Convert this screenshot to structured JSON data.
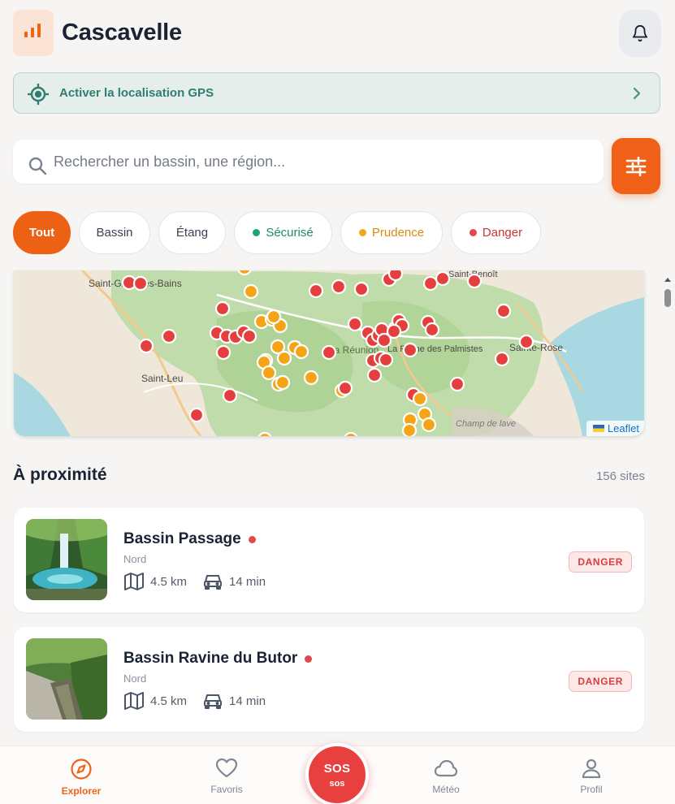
{
  "app": {
    "title": "Cascavelle"
  },
  "gps": {
    "label": "Activer la localisation GPS"
  },
  "search": {
    "placeholder": "Rechercher un bassin, une région..."
  },
  "filters": [
    {
      "label": "Tout",
      "active": true
    },
    {
      "label": "Bassin"
    },
    {
      "label": "Étang"
    },
    {
      "label": "Sécurisé",
      "dot_color": "#1aa37e",
      "text_color": "#1a8d6e"
    },
    {
      "label": "Prudence",
      "dot_color": "#f4a51b",
      "text_color": "#d98a10"
    },
    {
      "label": "Danger",
      "dot_color": "#e54848",
      "text_color": "#c93434"
    }
  ],
  "map": {
    "place_labels": [
      "Saint-Gilles-les-Bains",
      "Saint-Leu",
      "La Réunion",
      "La Plaine des Palmistes",
      "Saint-Benoît",
      "Sainte-Rose",
      "Champ de lave"
    ],
    "attribution": "Leaflet",
    "marker_colors": {
      "danger": "#e53e3e",
      "prudence": "#f5a417"
    }
  },
  "nearby": {
    "title": "À proximité",
    "count": "156 sites",
    "cards": [
      {
        "name": "Bassin Passage",
        "region": "Nord",
        "distance": "4.5 km",
        "duration": "14 min",
        "badge": "DANGER"
      },
      {
        "name": "Bassin Ravine du Butor",
        "region": "Nord",
        "distance": "4.5 km",
        "duration": "14 min",
        "badge": "DANGER"
      }
    ]
  },
  "nav": {
    "explorer": "Explorer",
    "favoris": "Favoris",
    "sos_main": "SOS",
    "sos_sub": "sos",
    "meteo": "Météo",
    "profil": "Profil"
  },
  "colors": {
    "accent": "#f06018",
    "danger": "#e54848",
    "safe": "#1aa37e",
    "caution": "#f4a51b"
  }
}
